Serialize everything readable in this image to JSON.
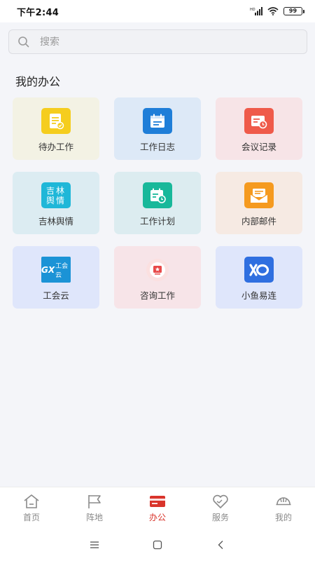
{
  "status_bar": {
    "time": "下午2:44",
    "battery": "99"
  },
  "search": {
    "placeholder": "搜索"
  },
  "section": {
    "title": "我的办公"
  },
  "tiles": [
    {
      "label": "待办工作",
      "icon": "todo-doc-icon",
      "bg": "#f3f2e4",
      "icon_color": "#f5cd1e"
    },
    {
      "label": "工作日志",
      "icon": "work-log-icon",
      "bg": "#dde9f7",
      "icon_color": "#1f7ed8"
    },
    {
      "label": "会议记录",
      "icon": "meeting-record-icon",
      "bg": "#f7e4e7",
      "icon_color": "#ef5a4a"
    },
    {
      "label": "吉林舆情",
      "icon": "jilin-opinion-icon",
      "bg": "#dcecf2",
      "icon_color": "#1fb7d8",
      "icon_text": [
        "吉林",
        "舆情"
      ]
    },
    {
      "label": "工作计划",
      "icon": "work-plan-icon",
      "bg": "#dcecf0",
      "icon_color": "#18b89a"
    },
    {
      "label": "内部邮件",
      "icon": "internal-mail-icon",
      "bg": "#f6eae3",
      "icon_color": "#f59a1f"
    },
    {
      "label": "工会云",
      "icon": "union-cloud-icon",
      "bg": "#dfe6fb",
      "icon_color": "#1b93d6",
      "icon_text": [
        "GX",
        "工会云"
      ]
    },
    {
      "label": "咨询工作",
      "icon": "consult-work-icon",
      "bg": "#f7e4e8",
      "icon_color": "#e84a4a"
    },
    {
      "label": "小鱼易连",
      "icon": "xiaoyu-yilian-icon",
      "bg": "#dfe6fb",
      "icon_color": "#2f6fe0"
    }
  ],
  "bottom_nav": [
    {
      "label": "首页",
      "icon": "home-icon",
      "active": false
    },
    {
      "label": "阵地",
      "icon": "flag-icon",
      "active": false
    },
    {
      "label": "办公",
      "icon": "office-card-icon",
      "active": true
    },
    {
      "label": "服务",
      "icon": "heart-hands-icon",
      "active": false
    },
    {
      "label": "我的",
      "icon": "helmet-icon",
      "active": false
    }
  ],
  "colors": {
    "accent": "#d9342b",
    "nav_inactive": "#8a8a8a",
    "background": "#f4f5f9"
  }
}
